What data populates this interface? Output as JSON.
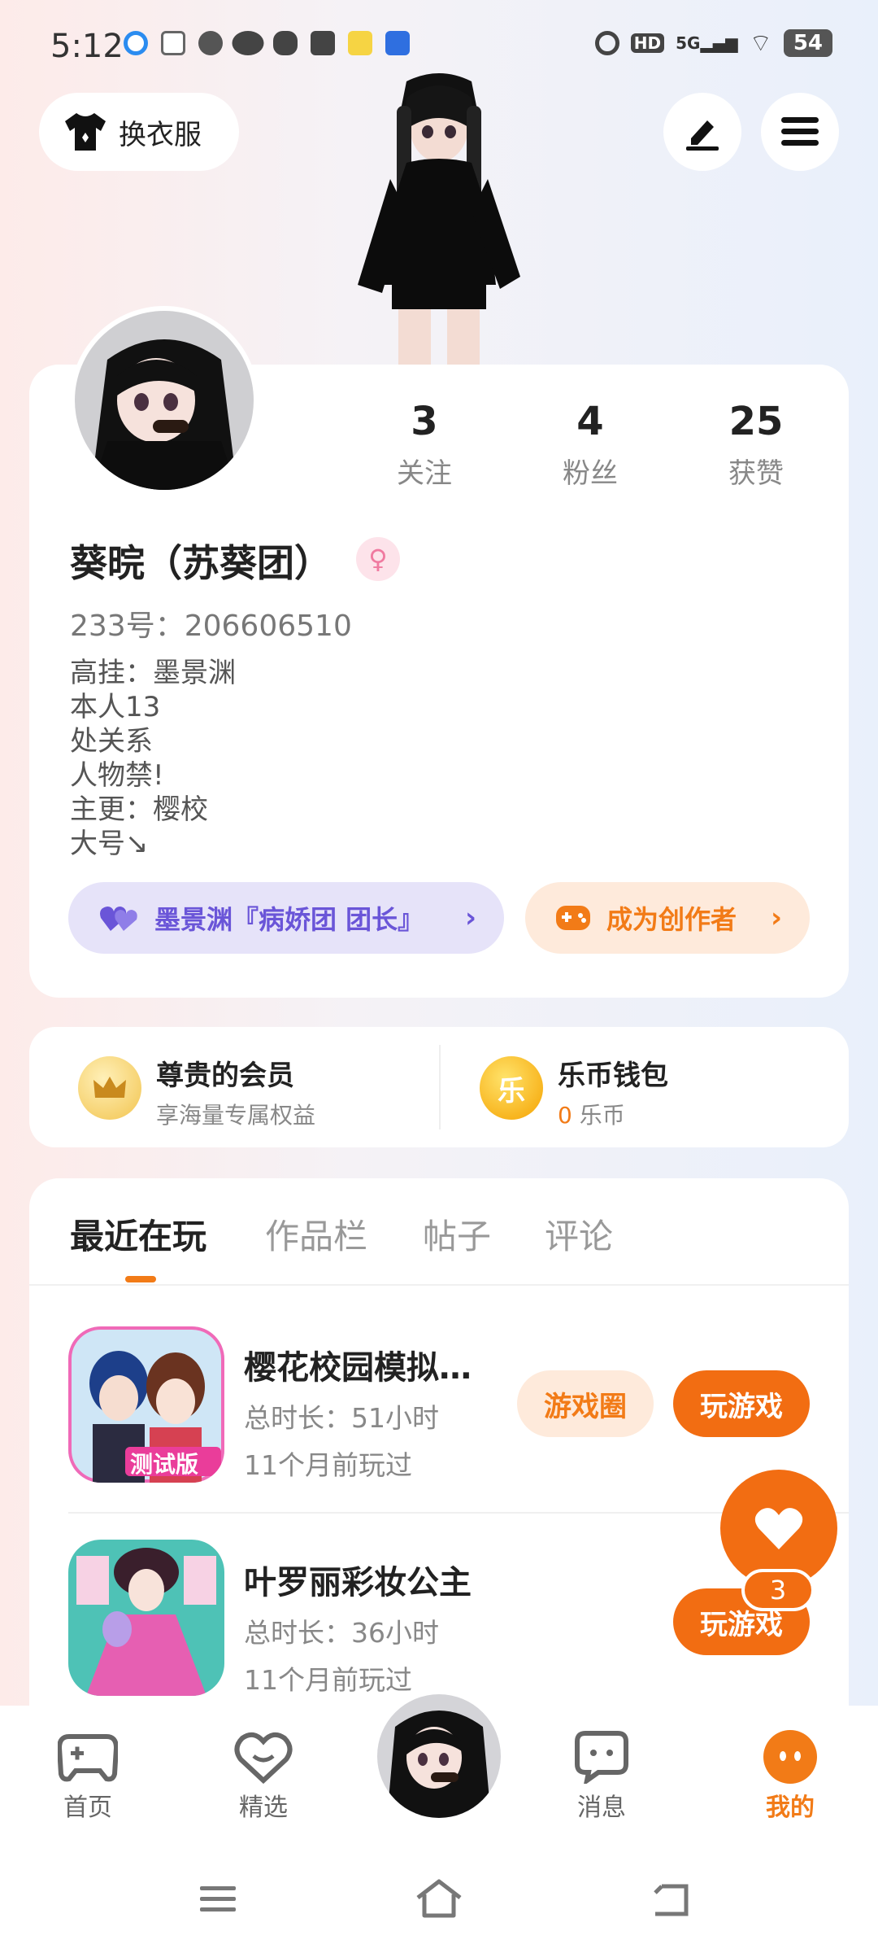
{
  "status_bar": {
    "time": "5:12",
    "network": "5G",
    "hd": "HD",
    "battery": "54"
  },
  "header": {
    "outfit_label": "换衣服"
  },
  "profile": {
    "stats": [
      {
        "value": "3",
        "label": "关注"
      },
      {
        "value": "4",
        "label": "粉丝"
      },
      {
        "value": "25",
        "label": "获赞"
      }
    ],
    "username": "葵晥（苏葵团）",
    "gender_symbol": "♀",
    "uid": "233号：206606510",
    "bio_lines": [
      "高挂：墨景渊",
      "本人13",
      "处关系",
      "人物禁!",
      "主更：樱校",
      "大号↘"
    ],
    "group_label": "墨景渊『病娇团 团长』",
    "creator_label": "成为创作者",
    "chevron": "›"
  },
  "member": {
    "title": "尊贵的会员",
    "subtitle": "享海量专属权益"
  },
  "wallet": {
    "title": "乐币钱包",
    "icon_text": "乐",
    "amount": "0",
    "unit": "乐币"
  },
  "tabs": [
    {
      "label": "最近在玩",
      "active": true
    },
    {
      "label": "作品栏",
      "active": false
    },
    {
      "label": "帖子",
      "active": false
    },
    {
      "label": "评论",
      "active": false
    }
  ],
  "games": [
    {
      "title": "樱花校园模拟…",
      "duration": "总时长：51小时",
      "last_played": "11个月前玩过",
      "circle_label": "游戏圈",
      "play_label": "玩游戏",
      "icon_badge": "测试版"
    },
    {
      "title": "叶罗丽彩妆公主",
      "duration": "总时长：36小时",
      "last_played": "11个月前玩过",
      "play_label": "玩游戏"
    }
  ],
  "floating": {
    "badge_count": "3"
  },
  "bottom_nav": [
    {
      "label": "首页"
    },
    {
      "label": "精选"
    },
    {
      "label": "消息"
    },
    {
      "label": "我的"
    }
  ],
  "colors": {
    "accent": "#f27b17",
    "purple": "#6a55d8"
  }
}
